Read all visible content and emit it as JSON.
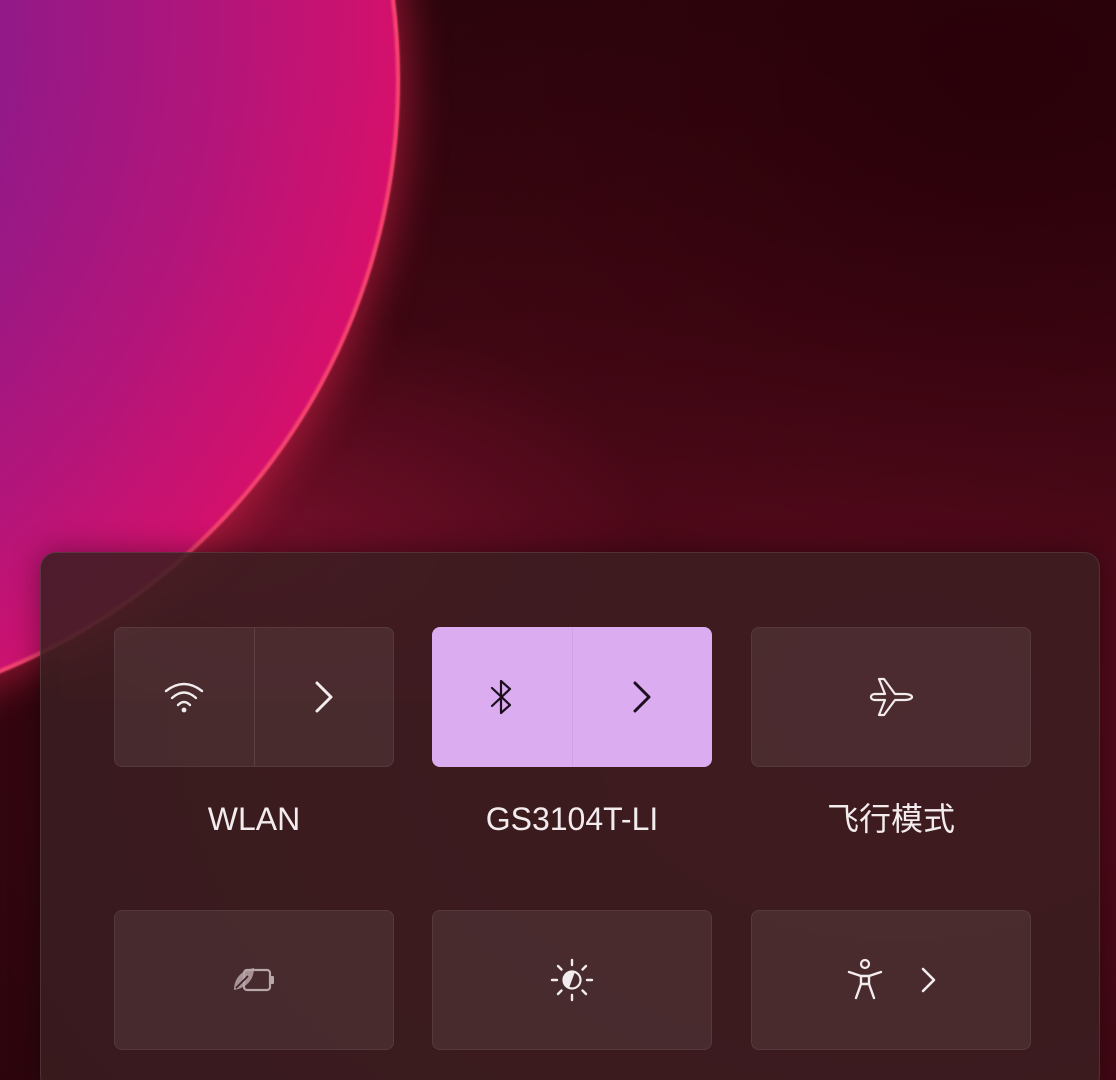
{
  "quick_settings": {
    "tiles": [
      {
        "id": "wlan",
        "label": "WLAN",
        "icon": "wifi-icon",
        "secondary_icon": "chevron-right-icon",
        "active": false
      },
      {
        "id": "bluetooth",
        "label": "GS3104T-LI",
        "icon": "bluetooth-icon",
        "secondary_icon": "chevron-right-icon",
        "active": true
      },
      {
        "id": "airplane",
        "label": "飞行模式",
        "icon": "airplane-icon",
        "active": false
      },
      {
        "id": "energy-saver",
        "label": "",
        "icon": "energy-saver-icon",
        "active": false
      },
      {
        "id": "night-light",
        "label": "",
        "icon": "brightness-icon",
        "active": false
      },
      {
        "id": "accessibility",
        "label": "",
        "icon": "accessibility-icon",
        "secondary_icon": "chevron-right-icon",
        "active": false
      }
    ]
  },
  "colors": {
    "active_tile": "#dcacf0",
    "panel_bg": "#3a1e21",
    "text": "#f3ecef"
  }
}
